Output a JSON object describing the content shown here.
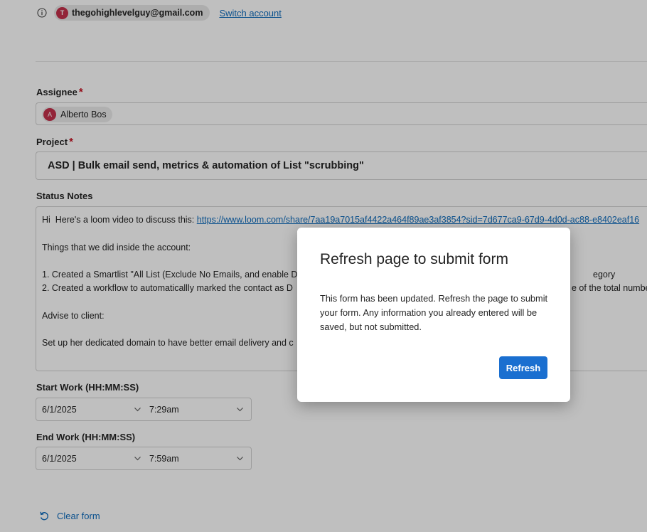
{
  "account": {
    "avatar_initial": "T",
    "email": "thegohighlevelguy@gmail.com",
    "switch_label": "Switch account"
  },
  "assignee": {
    "label": "Assignee",
    "required_mark": "*",
    "avatar_initial": "A",
    "value": "Alberto Bos"
  },
  "project": {
    "label": "Project",
    "required_mark": "*",
    "value": "ASD | Bulk email send, metrics & automation of List \"scrubbing\""
  },
  "status_notes": {
    "label": "Status Notes",
    "line1_prefix": "Hi  Here's a loom video to discuss this: ",
    "line1_link": "https://www.loom.com/share/7aa19a7015af4422a464f89ae3af3854?sid=7d677ca9-67d9-4d0d-ac88-e8402eaf16",
    "line2": "Things that we did inside the account:",
    "line3": "1. Created a Smartlist \"All List (Exclude No Emails, and enable DN",
    "line3_tail": "egory",
    "line4": "2. Created a workflow to automaticallly marked the contact as D",
    "line4_tail": "e of the total numbe",
    "line5": "Advise to client:",
    "line6": "Set up her dedicated domain to have better email delivery and c"
  },
  "start_work": {
    "label": "Start Work (HH:MM:SS)",
    "date": "6/1/2025",
    "time": "7:29am"
  },
  "end_work": {
    "label": "End Work (HH:MM:SS)",
    "date": "6/1/2025",
    "time": "7:59am"
  },
  "clear_form_label": "Clear form",
  "dialog": {
    "title": "Refresh page to submit form",
    "body": "This form has been updated. Refresh the page to submit your form. Any information you already entered will be saved, but not submitted.",
    "button_label": "Refresh"
  },
  "colors": {
    "accent": "#0f6cbd",
    "button": "#1a6fd0",
    "avatar": "#c4314b",
    "required": "#c50f1f"
  }
}
